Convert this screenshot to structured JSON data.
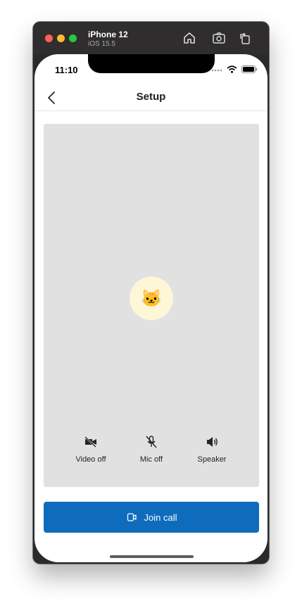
{
  "simulator": {
    "device_name": "iPhone 12",
    "os_version": "iOS 15.5",
    "toolbar_icons": [
      "home-icon",
      "screenshot-icon",
      "rotate-icon"
    ]
  },
  "status_bar": {
    "time": "11:10",
    "icons": [
      "signal-dots-icon",
      "wifi-icon",
      "battery-icon"
    ]
  },
  "nav": {
    "title": "Setup",
    "back_icon": "chevron-left-icon"
  },
  "preview": {
    "avatar_emoji": "🐱",
    "background_color": "#e1e1e1",
    "avatar_color": "#fdf7d7",
    "controls": [
      {
        "label": "Video off",
        "icon": "video-off-icon"
      },
      {
        "label": "Mic off",
        "icon": "mic-off-icon"
      },
      {
        "label": "Speaker",
        "icon": "speaker-icon"
      }
    ]
  },
  "join": {
    "label": "Join call",
    "icon": "call-icon",
    "color": "#0f6cbd"
  }
}
